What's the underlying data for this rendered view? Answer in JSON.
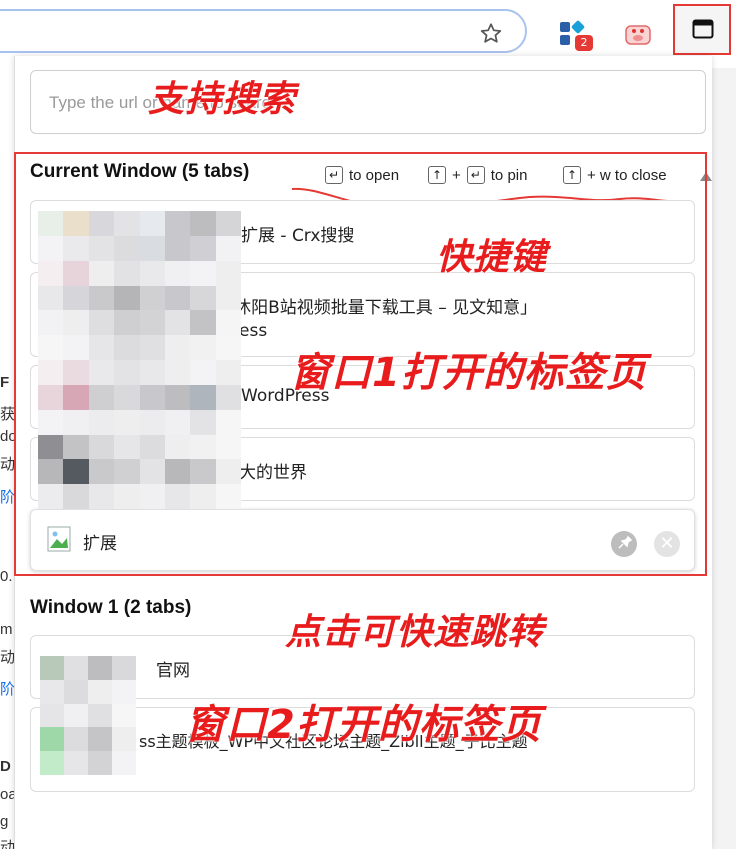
{
  "browser": {
    "extension_badge": "2"
  },
  "left_page_fragments": [
    "F",
    "获",
    "do",
    "动",
    "阶",
    "0.",
    "m",
    "动",
    "阶",
    "D",
    "oa",
    "g",
    "动"
  ],
  "search": {
    "placeholder": "Type the url or name to search"
  },
  "current_window": {
    "title": "Current Window (5 tabs)",
    "tabs": [
      {
        "title": "扩展 - Crx搜搜"
      },
      {
        "title_line1": "| 沐阳B站视频批量下载工具 – 见文知意」",
        "title_line2": "ess"
      },
      {
        "title": "WordPress"
      },
      {
        "title": "大的世界"
      },
      {
        "title": "扩展"
      }
    ]
  },
  "hints": {
    "open_key": "↵",
    "open_label": "to open",
    "pin_key1": "↑",
    "plus": "+",
    "pin_key2": "↵",
    "pin_label": "to pin",
    "close_key": "↑",
    "close_label": "+ w to close"
  },
  "window1": {
    "title": "Window 1 (2 tabs)",
    "tabs": [
      {
        "title": "官网"
      },
      {
        "title": "ss主题模板_WP中文社区论坛主题_Zibll主题_子比主题"
      }
    ]
  },
  "annotations": {
    "search_support": "支持搜索",
    "shortcuts": "快捷键",
    "window1_tabs": "窗口1打开的标签页",
    "click_jump": "点击可快速跳转",
    "window2_tabs": "窗口2打开的标签页"
  },
  "colors": {
    "annotation_red": "#e81c1c",
    "frame_red": "#e53935"
  }
}
